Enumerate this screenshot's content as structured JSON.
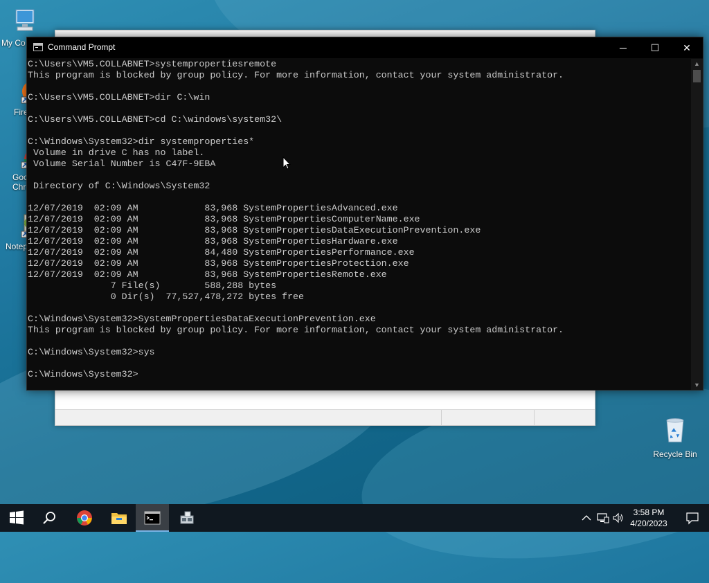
{
  "desktop": {
    "icons": [
      {
        "label": "My Co"
      },
      {
        "label": "Fire"
      },
      {
        "label": "Goo Chro"
      },
      {
        "label": "Notep"
      },
      {
        "label": "Recycle Bin"
      }
    ]
  },
  "cmd_window": {
    "title": "Command Prompt",
    "controls": {
      "minimize": "─",
      "maximize": "☐",
      "close": "✕"
    },
    "lines": [
      "C:\\Users\\VM5.COLLABNET>systempropertiesremote",
      "This program is blocked by group policy. For more information, contact your system administrator.",
      "",
      "C:\\Users\\VM5.COLLABNET>dir C:\\win",
      "",
      "C:\\Users\\VM5.COLLABNET>cd C:\\windows\\system32\\",
      "",
      "C:\\Windows\\System32>dir systemproperties*",
      " Volume in drive C has no label.",
      " Volume Serial Number is C47F-9EBA",
      "",
      " Directory of C:\\Windows\\System32",
      "",
      "12/07/2019  02:09 AM            83,968 SystemPropertiesAdvanced.exe",
      "12/07/2019  02:09 AM            83,968 SystemPropertiesComputerName.exe",
      "12/07/2019  02:09 AM            83,968 SystemPropertiesDataExecutionPrevention.exe",
      "12/07/2019  02:09 AM            83,968 SystemPropertiesHardware.exe",
      "12/07/2019  02:09 AM            84,480 SystemPropertiesPerformance.exe",
      "12/07/2019  02:09 AM            83,968 SystemPropertiesProtection.exe",
      "12/07/2019  02:09 AM            83,968 SystemPropertiesRemote.exe",
      "               7 File(s)        588,288 bytes",
      "               0 Dir(s)  77,527,478,272 bytes free",
      "",
      "C:\\Windows\\System32>SystemPropertiesDataExecutionPrevention.exe",
      "This program is blocked by group policy. For more information, contact your system administrator.",
      "",
      "C:\\Windows\\System32>sys",
      "",
      "C:\\Windows\\System32>"
    ]
  },
  "taskbar": {
    "items": [
      {
        "icon": "windows-start-icon"
      },
      {
        "icon": "search-icon"
      },
      {
        "icon": "chrome-icon"
      },
      {
        "icon": "file-explorer-icon"
      },
      {
        "icon": "command-prompt-icon"
      },
      {
        "icon": "network-app-icon"
      }
    ],
    "clock": {
      "time": "3:58 PM",
      "date": "4/20/2023"
    }
  },
  "colors": {
    "console_bg": "#0c0c0c",
    "console_text": "#cccccc",
    "taskbar_bg": "#101820",
    "desktop_bg": "#1f78a0"
  }
}
